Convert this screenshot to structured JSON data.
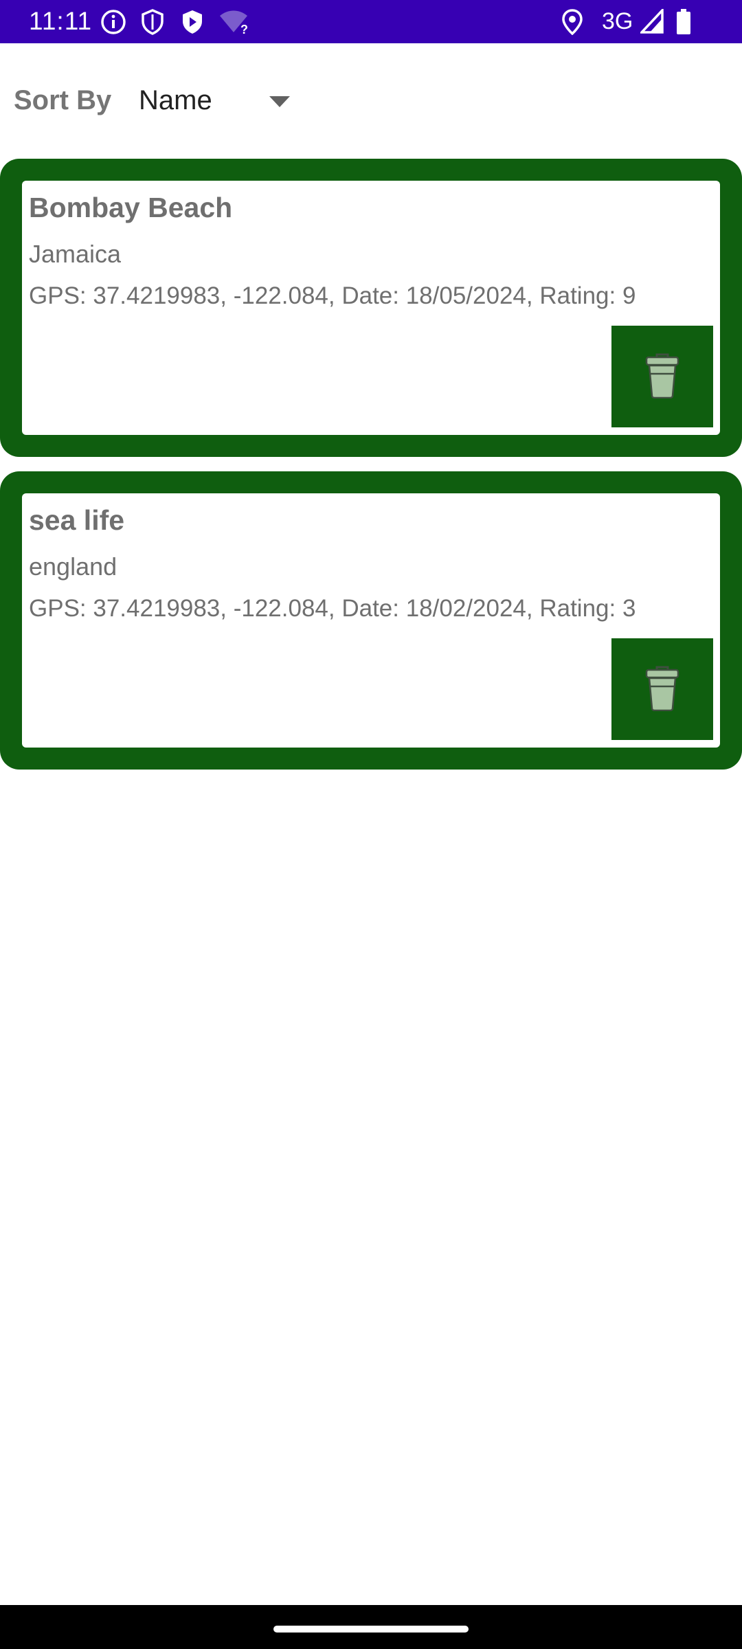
{
  "status_bar": {
    "time": "11:11",
    "network": "3G",
    "icons": [
      "info-icon",
      "shield-icon",
      "play-protect-icon",
      "wifi-unknown-icon",
      "location-icon",
      "signal-icon",
      "battery-icon"
    ]
  },
  "sort": {
    "label": "Sort By",
    "selected": "Name"
  },
  "entries": [
    {
      "title": "Bombay Beach",
      "location": "Jamaica",
      "details": "GPS: 37.4219983, -122.084, Date: 18/05/2024, Rating: 9"
    },
    {
      "title": "sea life",
      "location": "england",
      "details": "GPS: 37.4219983, -122.084, Date: 18/02/2024, Rating: 3"
    }
  ],
  "colors": {
    "status_bar": "#3700b3",
    "card_border": "#0f5e0f",
    "delete_button": "#0f5e0f",
    "text_gray": "#6f6f6f"
  }
}
